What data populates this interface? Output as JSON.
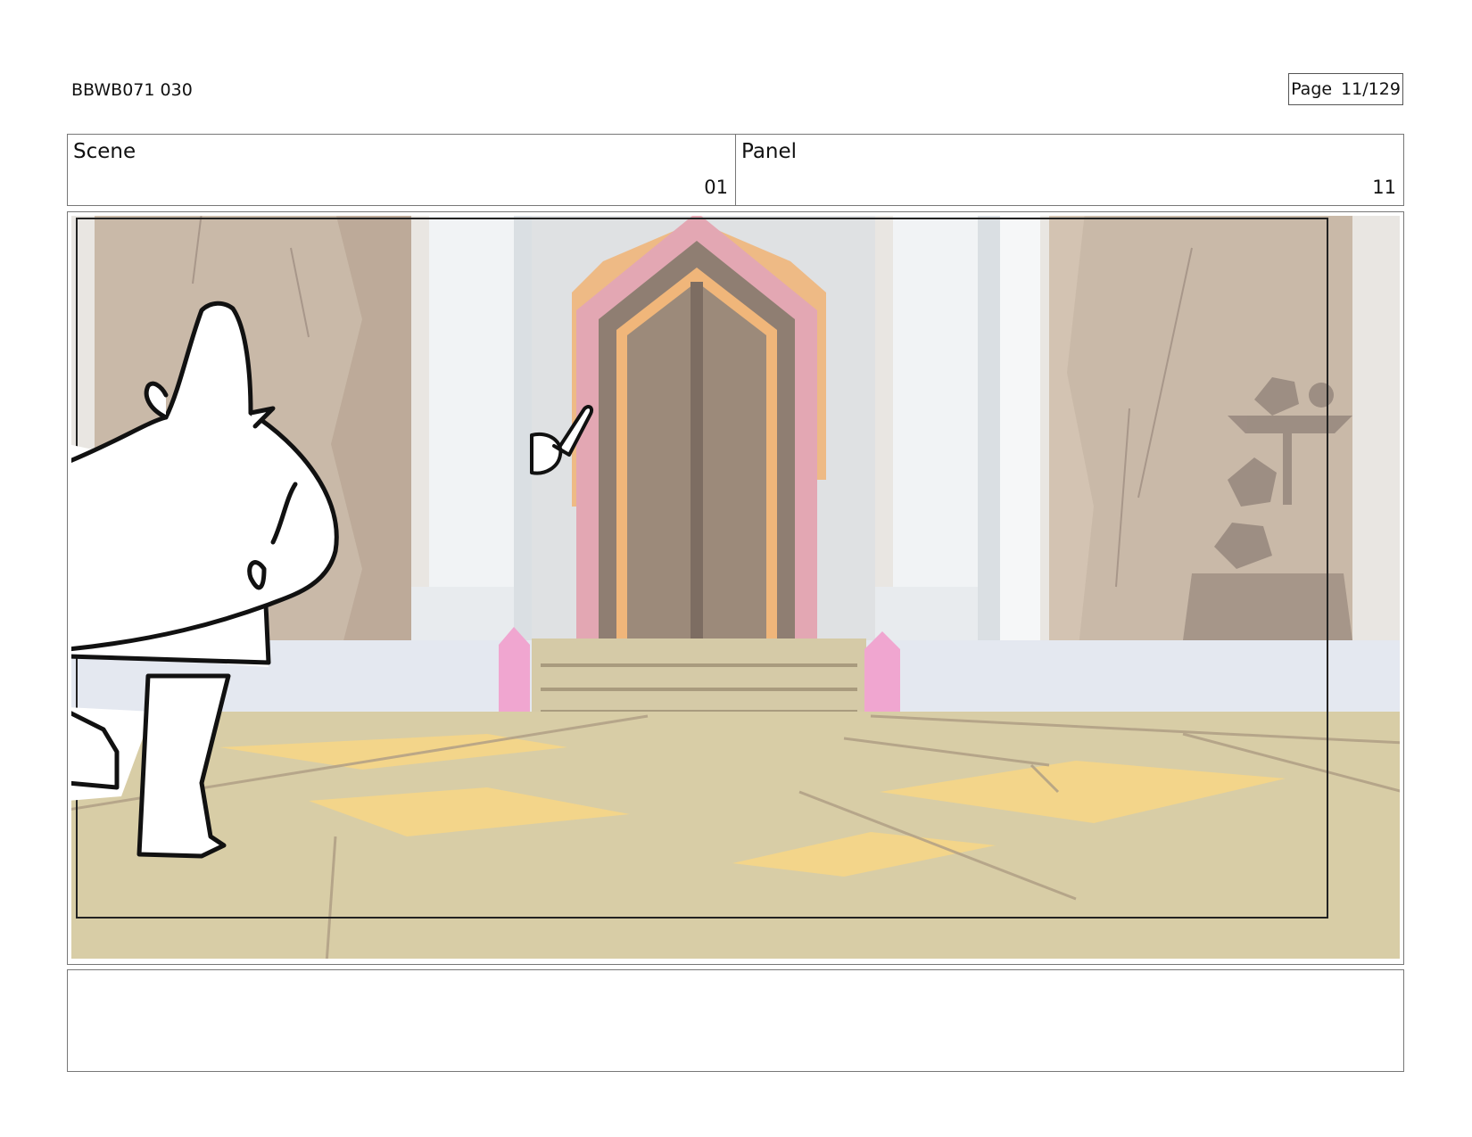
{
  "header": {
    "doc_id": "BBWB071 030",
    "page_label": "Page",
    "page_number": "11/129"
  },
  "info": {
    "scene_label": "Scene",
    "scene_value": "01",
    "panel_label": "Panel",
    "panel_value": "11"
  },
  "panel_image": {
    "colors": {
      "wall": "#c9b9a8",
      "pillar": "#eef0f2",
      "floor": "#d8cda6",
      "floor_light": "#f3d58a",
      "door": "#9c8a7a",
      "door_frame_pink": "#e3a7b3",
      "door_frame_orange": "#f0b67a",
      "crystal": "#f0a6d0",
      "ink": "#111111"
    }
  },
  "notes": {
    "text": ""
  }
}
